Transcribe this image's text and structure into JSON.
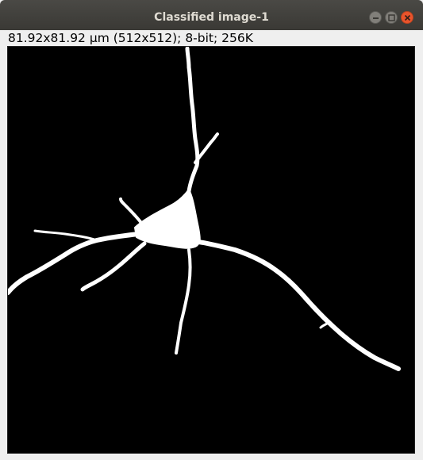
{
  "window": {
    "title": "Classified image-1",
    "controls": {
      "minimize": "minimize-icon",
      "maximize": "maximize-icon",
      "close": "close-icon"
    }
  },
  "image_info": {
    "text": "81.92x81.92 µm (512x512); 8-bit; 256K"
  },
  "image": {
    "background_color": "#000000",
    "foreground_color": "#ffffff",
    "content": "binary segmentation mask of a neuron"
  }
}
